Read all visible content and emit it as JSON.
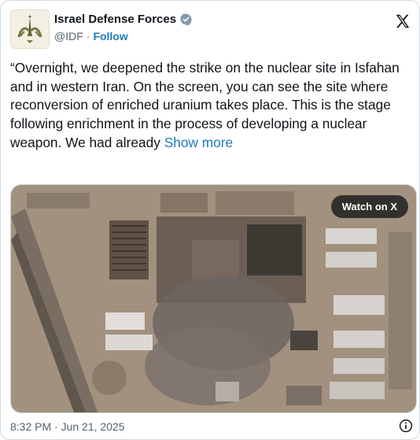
{
  "post": {
    "author_name": "Israel Defense Forces",
    "handle": "@IDF",
    "separator": "·",
    "follow_label": "Follow",
    "text": "“Overnight, we deepened the strike on the nuclear site in Isfahan and in western Iran. On the screen, you can see the site where reconversion of enriched uranium takes place. This is the stage following enrichment in the process of developing a nuclear weapon. We had already",
    "show_more_label": "Show more",
    "watch_label": "Watch on X",
    "timestamp": "8:32 PM · Jun 21, 2025"
  },
  "icons": {
    "verified": "verified-badge-icon",
    "x_logo": "x-logo-icon",
    "info": "info-icon"
  },
  "colors": {
    "link": "#1d7ab8",
    "verified_badge": "#829aab"
  }
}
